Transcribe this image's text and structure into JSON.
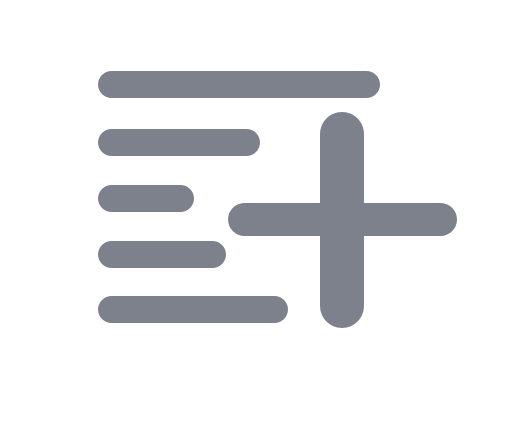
{
  "icon": {
    "name": "add-to-list-icon",
    "color": "#7d818c",
    "background": "#ffffff"
  }
}
